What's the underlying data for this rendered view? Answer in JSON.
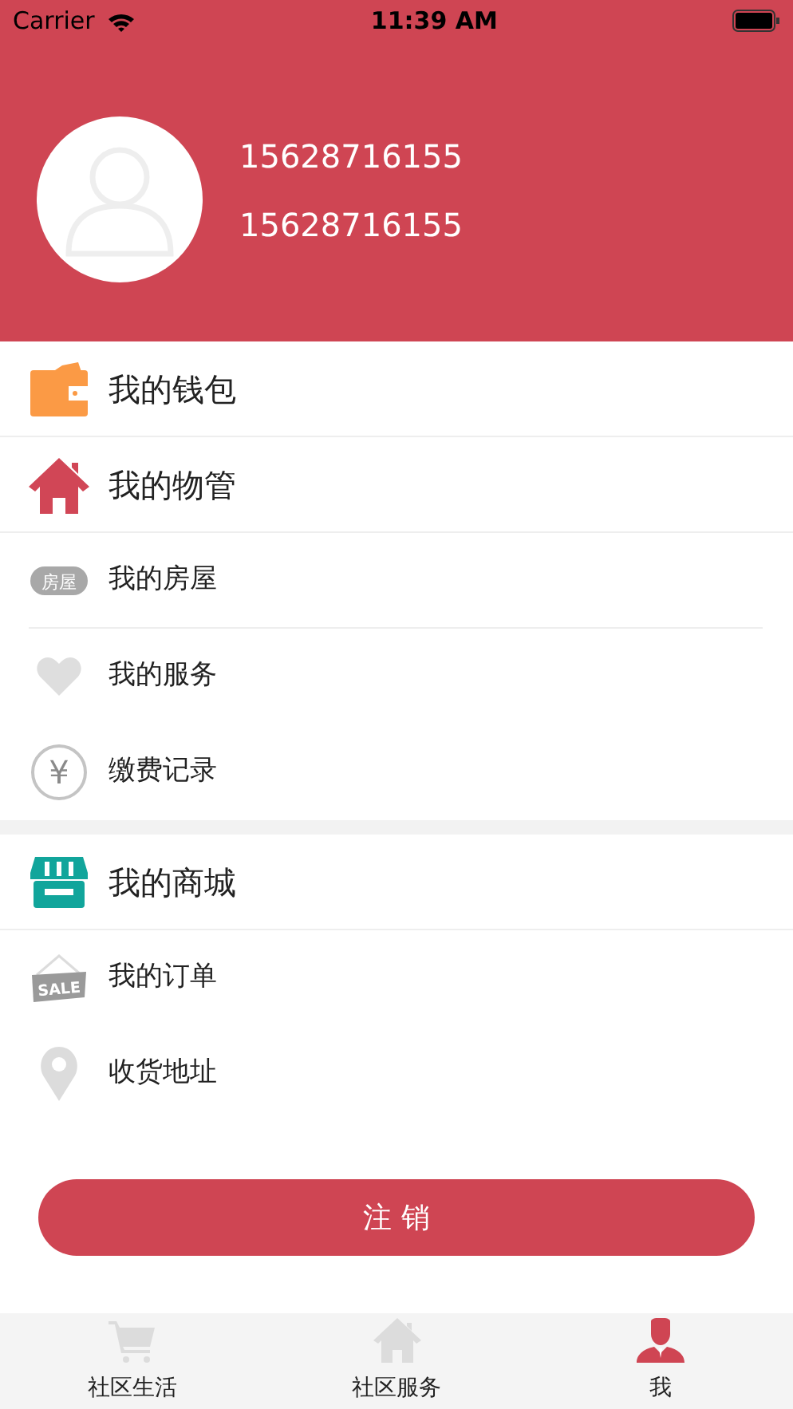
{
  "status_bar": {
    "carrier": "Carrier",
    "time": "11:39 AM"
  },
  "profile": {
    "lines": [
      "15628716155",
      "15628716155"
    ]
  },
  "sections": [
    {
      "rows": [
        {
          "kind": "header",
          "label": "我的钱包",
          "divider_below": true
        }
      ]
    },
    {
      "rows": [
        {
          "kind": "header",
          "label": "我的物管",
          "divider_below": true
        },
        {
          "kind": "item",
          "label": "我的房屋",
          "icon_text": "房屋",
          "divider_below": true
        },
        {
          "kind": "item",
          "label": "我的服务",
          "divider_below": false
        },
        {
          "kind": "item",
          "label": "缴费记录",
          "icon_text": "¥",
          "divider_below": false
        }
      ]
    },
    {
      "rows": [
        {
          "kind": "header",
          "label": "我的商城",
          "divider_below": true
        },
        {
          "kind": "item",
          "label": "我的订单",
          "icon_text": "SALE",
          "divider_below": false
        },
        {
          "kind": "item",
          "label": "收货地址",
          "divider_below": false
        }
      ]
    }
  ],
  "logout_button": "注 销",
  "tabs": [
    {
      "label": "社区生活",
      "selected": false
    },
    {
      "label": "社区服务",
      "selected": false
    },
    {
      "label": "我",
      "selected": true
    }
  ]
}
